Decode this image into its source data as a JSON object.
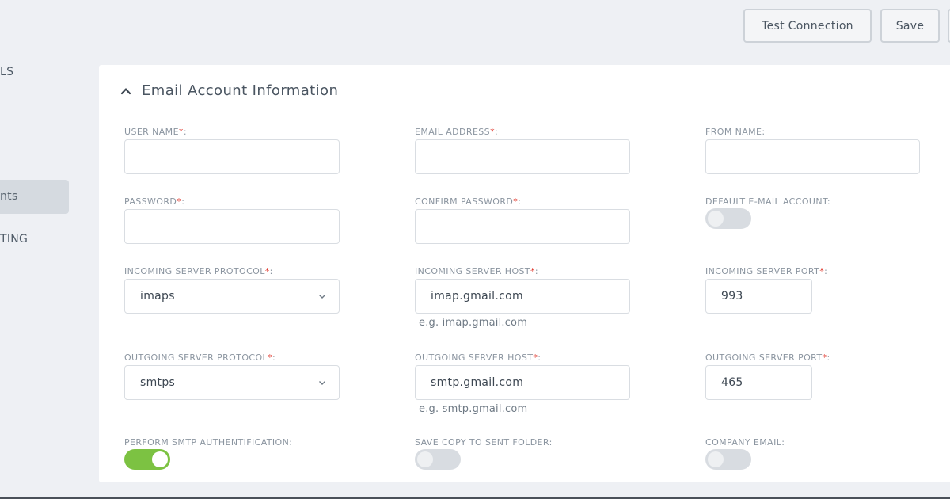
{
  "sidebar": {
    "items": [
      {
        "label": "LS"
      },
      {
        "label": "nts",
        "active": true
      },
      {
        "label": "TING"
      }
    ]
  },
  "toolbar": {
    "test_label": "Test Connection",
    "save_label": "Save"
  },
  "section": {
    "title": "Email Account Information",
    "chevron_icon": "chevron-up-icon"
  },
  "fields": {
    "user_name": {
      "label": "USER NAME",
      "required": "*",
      "colon": ":",
      "value": ""
    },
    "email_address": {
      "label": "EMAIL ADDRESS",
      "required": "*",
      "colon": ":",
      "value": ""
    },
    "from_name": {
      "label": "FROM NAME:",
      "value": ""
    },
    "password": {
      "label": "PASSWORD",
      "required": "*",
      "colon": ":",
      "value": ""
    },
    "confirm_password": {
      "label": "CONFIRM PASSWORD",
      "required": "*",
      "colon": ":",
      "value": ""
    },
    "default_account": {
      "label": "DEFAULT E-MAIL ACCOUNT:",
      "state": "off"
    },
    "incoming_protocol": {
      "label": "INCOMING SERVER PROTOCOL",
      "required": "*",
      "colon": ":",
      "value": "imaps"
    },
    "incoming_host": {
      "label": "INCOMING SERVER HOST",
      "required": "*",
      "colon": ":",
      "value": "imap.gmail.com",
      "hint": "e.g. imap.gmail.com"
    },
    "incoming_port": {
      "label": "INCOMING SERVER PORT",
      "required": "*",
      "colon": ":",
      "value": "993"
    },
    "outgoing_protocol": {
      "label": "OUTGOING SERVER PROTOCOL",
      "required": "*",
      "colon": ":",
      "value": "smtps"
    },
    "outgoing_host": {
      "label": "OUTGOING SERVER HOST",
      "required": "*",
      "colon": ":",
      "value": "smtp.gmail.com",
      "hint": "e.g. smtp.gmail.com"
    },
    "outgoing_port": {
      "label": "OUTGOING SERVER PORT",
      "required": "*",
      "colon": ":",
      "value": "465"
    },
    "smtp_auth": {
      "label": "PERFORM SMTP AUTHENTIFICATION:",
      "state": "on"
    },
    "save_copy": {
      "label": "SAVE COPY TO SENT FOLDER:",
      "state": "off"
    },
    "company_email": {
      "label": "COMPANY EMAIL:",
      "state": "off"
    }
  },
  "colors": {
    "required": "#e0362b",
    "toggle_on": "#7cc242",
    "toggle_off": "#d8dce1"
  }
}
